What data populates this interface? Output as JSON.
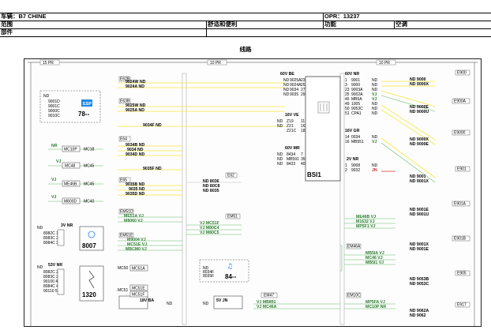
{
  "header": {
    "vehicle_label": "车辆：B7 CHINE",
    "opr_label": "OPR：13237",
    "range_label": "范围",
    "category": "舒适和便利",
    "function_label": "功能",
    "function_value": "空调",
    "parts_label": "部件",
    "section_title": "线路"
  },
  "connectors": {
    "c15": "15 PR",
    "c10": "10 PR",
    "c10b": "10 PR",
    "bsi_top_left_code": "60V BE",
    "bsi_top_right_code": "60V NR",
    "bsi_mid_left_code": "16V VE",
    "bsi_mid_right_code": "16V GR",
    "bsi_low_left_code": "60V MR",
    "bsi_low_right_code": "2V NR",
    "bsi_name": "BSI1",
    "nr_code": "3V NR",
    "nr_num": "8007",
    "nr2_code": "53V NR",
    "nr2_num": "1320",
    "esp_label": "ESP",
    "esp_num": "78--",
    "c84": "84--",
    "c18": "18V BA",
    "c5": "5V JN"
  },
  "left_box": {
    "lines": [
      "ND",
      "9001D",
      "9001C",
      "9000C",
      "9010C"
    ]
  },
  "left_mc": [
    {
      "color": "NR",
      "code": "MC10P",
      "tag": "MC18"
    },
    {
      "color": "VJ",
      "code": "MC48",
      "tag": "MC45"
    },
    {
      "color": "VJ",
      "code": "ME46B",
      "tag": "MC45"
    },
    {
      "color": "VJ",
      "code": "M800D",
      "tag": "MC40"
    }
  ],
  "nr_pins": {
    "head": "ND",
    "rows": [
      "8082C 1",
      "8083C 2",
      "8084C 3"
    ]
  },
  "nr2_pins": {
    "head": "ND",
    "rows": [
      "8082C 21",
      "8083C 27",
      "90100 40",
      "8084C 45",
      "90110 52"
    ]
  },
  "col2": [
    {
      "tag": "E62B",
      "lines": [
        "9024W ND",
        "9024A ND"
      ]
    },
    {
      "tag": "E63B",
      "lines": [
        "9025W ND",
        "9025A ND"
      ]
    },
    {
      "tag": "",
      "lines": [
        "9034F ND"
      ]
    },
    {
      "tag": "E64",
      "lines": [
        "9034B ND",
        "9034 ND",
        "9034D ND"
      ]
    },
    {
      "tag": "",
      "lines": [
        "9035F ND"
      ]
    },
    {
      "tag": "E65",
      "lines": [
        "9035B ND",
        "9035 ND",
        "9035D ND"
      ]
    },
    {
      "tag": "EM51D",
      "lines": [
        "ME51A VJ",
        "M8060 VJ"
      ]
    },
    {
      "tag": "EM51E",
      "lines": [
        "M9004 VJ",
        "MC51E VJ",
        "MBCM0 VJ"
      ]
    }
  ],
  "col2_mc": [
    {
      "label": "MC50",
      "code": "MC51A"
    },
    {
      "label": "MC51",
      "code": "MC51E",
      "code2": "MC51F"
    }
  ],
  "col3_nd": [
    "ND 8036",
    "ND 80C8",
    "ND 8035"
  ],
  "col3_e": "E62",
  "col3_vj": [
    "VJ MC51F",
    "VJ M80C4",
    "VJ M80C5"
  ],
  "col3_e2": "EM51",
  "col3_dash": [
    "ND",
    "8034F",
    "8035F"
  ],
  "col3_bottom": {
    "tag": "EM47",
    "lines": [
      "VJ MB891",
      "VJ MC46A"
    ]
  },
  "bsi_left_top": [
    {
      "n": "ND",
      "c": "9025A",
      "p": "23"
    },
    {
      "n": "ND",
      "c": "9024A",
      "p": "25"
    },
    {
      "n": "ND",
      "c": "9034",
      "p": "27"
    },
    {
      "n": "ND",
      "c": "9035",
      "p": "29"
    }
  ],
  "bsi_left_mid": [
    {
      "n": "ND",
      "c": "Z19",
      "p": "11"
    },
    {
      "n": "ND",
      "c": "Z21",
      "p": "16"
    },
    {
      "n": "",
      "c": "Z21C",
      "p": "18"
    }
  ],
  "bsi_left_low": [
    {
      "n": "ND",
      "c": "8434",
      "p": "7"
    },
    {
      "n": "ND",
      "c": "MB591",
      "p": "35"
    },
    {
      "n": "ND",
      "c": "8433",
      "p": "40"
    }
  ],
  "bsi_right_top": [
    {
      "p": "1",
      "c": "9001",
      "n": "ND"
    },
    {
      "p": "3",
      "c": "9000",
      "n": "ND"
    },
    {
      "p": "23",
      "c": "9003A",
      "n": "ND"
    },
    {
      "p": "25",
      "c": "9002A",
      "n": "VJ"
    },
    {
      "p": "45",
      "c": "MB5A",
      "n": "VJ"
    },
    {
      "p": "49",
      "c": "1005",
      "n": "ND"
    },
    {
      "p": "50",
      "c": "9053C",
      "n": "ND"
    },
    {
      "p": "51",
      "c": "CPA1",
      "n": "ND"
    }
  ],
  "bsi_right_mid": [
    {
      "p": "14",
      "c": "0034",
      "n": "ND"
    },
    {
      "p": "16",
      "c": "MB551",
      "n": "VJ"
    }
  ],
  "bsi_right_low": [
    {
      "p": "1",
      "c": "9008",
      "n": "ND"
    },
    {
      "p": "2",
      "c": "9032",
      "n": "JN"
    }
  ],
  "col5_vj": [
    "ME46B VJ",
    "M1632 VJ",
    "MP5F1 VJ"
  ],
  "col5_box": {
    "tag": "EM46A",
    "lines": [
      "MB5IA VJ",
      "MC46 VJ",
      "MB5I1 VJ"
    ]
  },
  "col5_bottom": {
    "tag": "EM10C",
    "lines": [
      "MP5FA VJ",
      "MC10P NR"
    ]
  },
  "right": [
    {
      "tag": "E900",
      "lines": [
        "ND 9000",
        "ND 9000X"
      ]
    },
    {
      "tag": "E900A",
      "lines": [
        "ND 9000E",
        "ND 9000U"
      ]
    },
    {
      "tag": "E9000",
      "lines": [
        "ND 9000X",
        "ND 9000E"
      ]
    },
    {
      "tag": "E901",
      "lines": [
        "ND 9001",
        "ND 9001X"
      ]
    },
    {
      "tag": "E901A",
      "lines": [
        "ND 9001E",
        "ND 9001U"
      ]
    },
    {
      "tag": "E901B",
      "lines": [
        "ND 9001X",
        "ND 9001E"
      ]
    },
    {
      "tag": "E905",
      "lines": [
        "ND 9053B",
        "ND 9053C"
      ]
    },
    {
      "tag": "E917",
      "lines": [
        "ND 9062A",
        "ND 9062"
      ]
    }
  ]
}
